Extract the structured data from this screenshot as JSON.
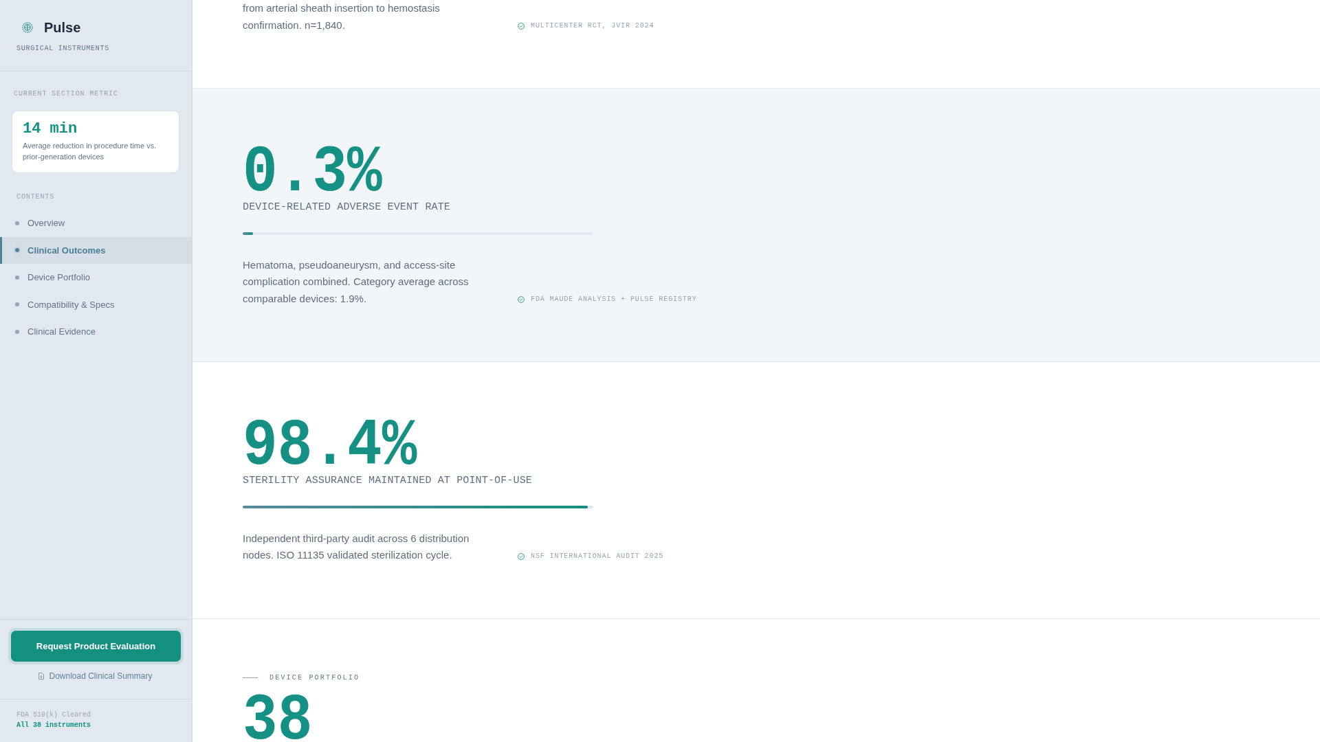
{
  "brand": {
    "name": "Pulse",
    "tagline": "SURGICAL INSTRUMENTS"
  },
  "metric_panel": {
    "heading": "CURRENT SECTION METRIC",
    "value": "14 min",
    "description": "Average reduction in procedure time vs. prior-generation devices"
  },
  "contents": {
    "heading": "CONTENTS",
    "items": [
      {
        "label": "Overview",
        "selected": false
      },
      {
        "label": "Clinical Outcomes",
        "selected": true
      },
      {
        "label": "Device Portfolio",
        "selected": false
      },
      {
        "label": "Compatibility & Specs",
        "selected": false
      },
      {
        "label": "Clinical Evidence",
        "selected": false
      }
    ]
  },
  "actions": {
    "primary_button": "Request Product Evaluation",
    "download_link": "Download Clinical Summary"
  },
  "certification": {
    "label": "FDA 510(k) Cleared",
    "scope": "All 38 instruments"
  },
  "sections": [
    {
      "kind": "stat_tail",
      "shaded": false,
      "description": "from arterial sheath insertion to hemostasis confirmation. n=1,840.",
      "source": "MULTICENTER RCT, JVIR 2024"
    },
    {
      "kind": "stat",
      "shaded": true,
      "value": "0.3%",
      "label": "DEVICE-RELATED ADVERSE EVENT RATE",
      "level": 0.03,
      "description": "Hematoma, pseudoaneurysm, and access-site complication combined. Category average across comparable devices: 1.9%.",
      "source": "FDA MAUDE ANALYSIS + PULSE REGISTRY"
    },
    {
      "kind": "stat",
      "shaded": false,
      "value": "98.4%",
      "label": "STERILITY ASSURANCE MAINTAINED AT POINT-OF-USE",
      "level": 0.984,
      "description": "Independent third-party audit across 6 distribution nodes. ISO 11135 validated sterilization cycle.",
      "source": "NSF INTERNATIONAL AUDIT 2025"
    },
    {
      "kind": "section_intro",
      "shaded": false,
      "eyebrow": "DEVICE PORTFOLIO",
      "value": "38"
    }
  ]
}
